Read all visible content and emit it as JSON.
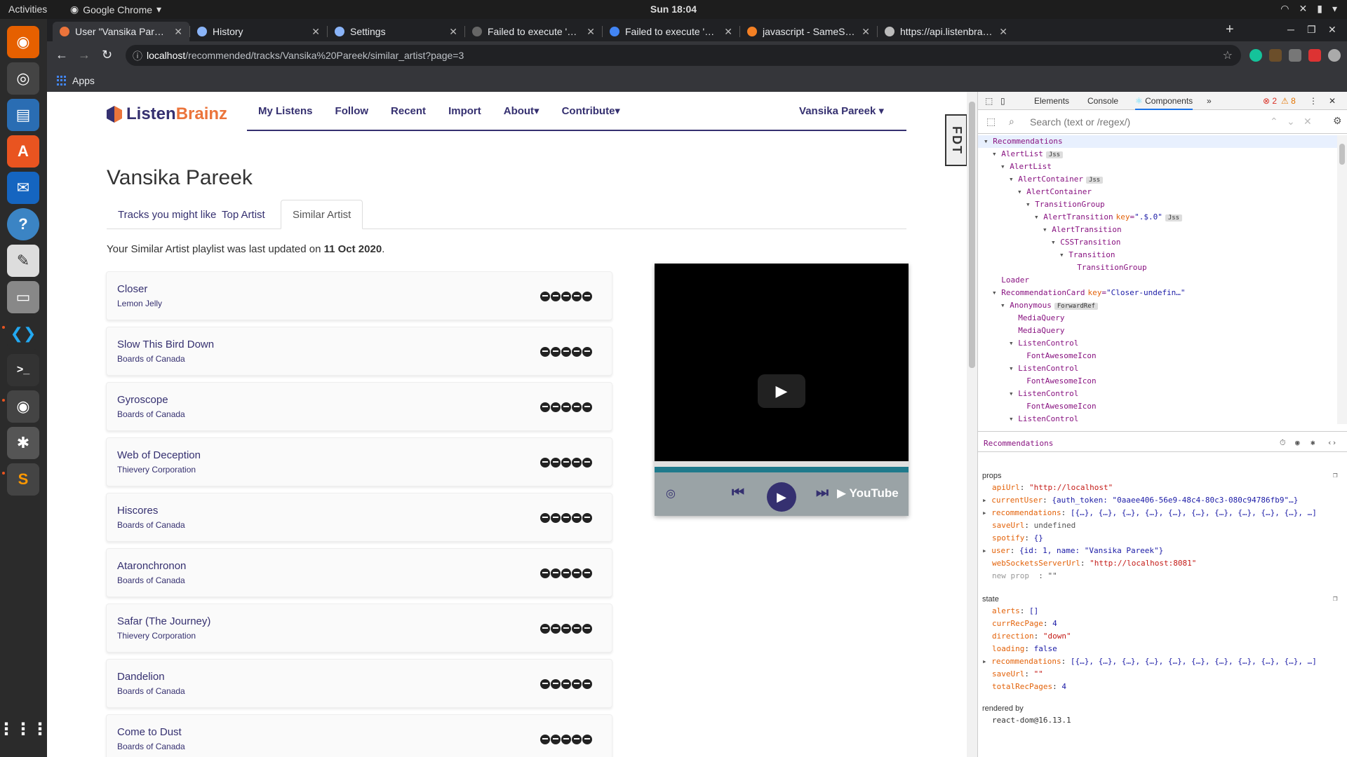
{
  "os": {
    "activities": "Activities",
    "app": "Google Chrome",
    "clock": "Sun 18:04"
  },
  "chrome": {
    "tabs": [
      {
        "title": "User \"Vansika Pareek\" - ListenBrainz",
        "color": "#eb743b"
      },
      {
        "title": "History",
        "color": "#8ab4f8"
      },
      {
        "title": "Settings",
        "color": "#8ab4f8"
      },
      {
        "title": "Failed to execute 'postMessage'",
        "color": "#666"
      },
      {
        "title": "Failed to execute 'postMessage'",
        "color": "#4285f4"
      },
      {
        "title": "javascript - SameSite warning",
        "color": "#f48024"
      },
      {
        "title": "https://api.listenbrainz.org",
        "color": "#bbb"
      }
    ],
    "url_host": "localhost",
    "url_path": "/recommended/tracks/Vansika%20Pareek/similar_artist?page=3",
    "bookmarks_apps": "Apps"
  },
  "site": {
    "brand1": "Listen",
    "brand2": "Brainz",
    "nav": [
      "My Listens",
      "Follow",
      "Recent",
      "Import",
      "About",
      "Contribute"
    ],
    "user": "Vansika Pareek",
    "fdt": "FDT",
    "title": "Vansika Pareek",
    "tabs": [
      "Tracks you might like",
      "Top Artist",
      "Similar Artist"
    ],
    "updated_prefix": "Your Similar Artist playlist was last updated on ",
    "updated_date": "11 Oct 2020",
    "updated_suffix": ".",
    "tracks": [
      {
        "name": "Closer",
        "artist": "Lemon Jelly"
      },
      {
        "name": "Slow This Bird Down",
        "artist": "Boards of Canada"
      },
      {
        "name": "Gyroscope",
        "artist": "Boards of Canada"
      },
      {
        "name": "Web of Deception",
        "artist": "Thievery Corporation"
      },
      {
        "name": "Hiscores",
        "artist": "Boards of Canada"
      },
      {
        "name": "Ataronchronon",
        "artist": "Boards of Canada"
      },
      {
        "name": "Safar (The Journey)",
        "artist": "Thievery Corporation"
      },
      {
        "name": "Dandelion",
        "artist": "Boards of Canada"
      },
      {
        "name": "Come to Dust",
        "artist": "Boards of Canada"
      }
    ],
    "player_logo": "YouTube"
  },
  "devtools": {
    "tabs": [
      "Elements",
      "Console",
      "Components"
    ],
    "errors": "2",
    "warnings": "8",
    "search_placeholder": "Search (text or /regex/)",
    "tree": [
      {
        "d": 0,
        "n": "Recommendations"
      },
      {
        "d": 1,
        "n": "AlertList",
        "b": "Jss"
      },
      {
        "d": 2,
        "n": "AlertList"
      },
      {
        "d": 3,
        "n": "AlertContainer",
        "b": "Jss"
      },
      {
        "d": 4,
        "n": "AlertContainer"
      },
      {
        "d": 5,
        "n": "TransitionGroup"
      },
      {
        "d": 6,
        "n": "AlertTransition",
        "k": "key",
        "v": "\".$.0\"",
        "b": "Jss"
      },
      {
        "d": 7,
        "n": "AlertTransition"
      },
      {
        "d": 8,
        "n": "CSSTransition"
      },
      {
        "d": 9,
        "n": "Transition"
      },
      {
        "d": 10,
        "n": "TransitionGroup"
      },
      {
        "d": 1,
        "n": "Loader"
      },
      {
        "d": 1,
        "n": "RecommendationCard",
        "k": "key",
        "v": "\"Closer-undefin…\""
      },
      {
        "d": 2,
        "n": "Anonymous",
        "b": "ForwardRef"
      },
      {
        "d": 3,
        "n": "MediaQuery"
      },
      {
        "d": 3,
        "n": "MediaQuery"
      },
      {
        "d": 3,
        "n": "ListenControl"
      },
      {
        "d": 4,
        "n": "FontAwesomeIcon"
      },
      {
        "d": 3,
        "n": "ListenControl"
      },
      {
        "d": 4,
        "n": "FontAwesomeIcon"
      },
      {
        "d": 3,
        "n": "ListenControl"
      },
      {
        "d": 4,
        "n": "FontAwesomeIcon"
      },
      {
        "d": 3,
        "n": "ListenControl"
      }
    ],
    "selected": "Recommendations",
    "props_label": "props",
    "props": [
      {
        "k": "apiUrl",
        "v": "\"http://localhost\"",
        "t": "s"
      },
      {
        "k": "currentUser",
        "v": "{auth_token: \"0aaee406-56e9-48c4-80c3-080c94786fb9\"…}",
        "t": "v",
        "e": true
      },
      {
        "k": "recommendations",
        "v": "[{…}, {…}, {…}, {…}, {…}, {…}, {…}, {…}, {…}, {…}, …]",
        "t": "v",
        "e": true
      },
      {
        "k": "saveUrl",
        "v": "undefined",
        "t": "o"
      },
      {
        "k": "spotify",
        "v": "{}",
        "t": "v"
      },
      {
        "k": "user",
        "v": "{id: 1, name: \"Vansika Pareek\"}",
        "t": "v",
        "e": true
      },
      {
        "k": "webSocketsServerUrl",
        "v": "\"http://localhost:8081\"",
        "t": "s"
      },
      {
        "k": "new prop",
        "v": ": \"\"",
        "t": "o"
      }
    ],
    "state_label": "state",
    "state": [
      {
        "k": "alerts",
        "v": "[]",
        "t": "v"
      },
      {
        "k": "currRecPage",
        "v": "4",
        "t": "v"
      },
      {
        "k": "direction",
        "v": "\"down\"",
        "t": "s"
      },
      {
        "k": "loading",
        "v": "false",
        "t": "v"
      },
      {
        "k": "recommendations",
        "v": "[{…}, {…}, {…}, {…}, {…}, {…}, {…}, {…}, {…}, {…}, …]",
        "t": "v",
        "e": true
      },
      {
        "k": "saveUrl",
        "v": "\"\"",
        "t": "s"
      },
      {
        "k": "totalRecPages",
        "v": "4",
        "t": "v"
      }
    ],
    "rendered_by_label": "rendered by",
    "rendered_by": "react-dom@16.13.1"
  }
}
